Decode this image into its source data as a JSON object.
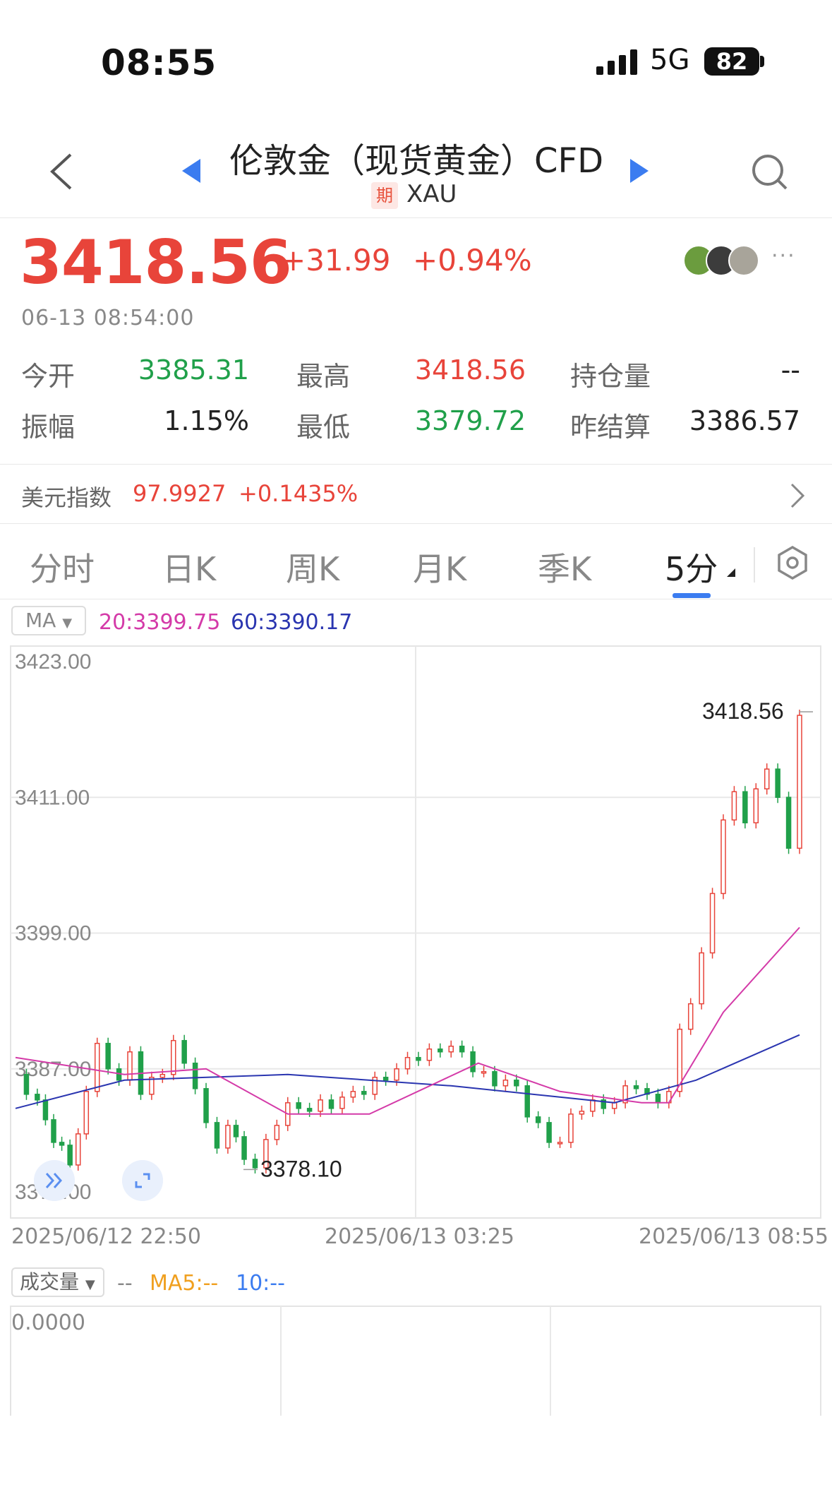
{
  "status": {
    "time": "08:55",
    "network": "5G",
    "battery": "82"
  },
  "header": {
    "title": "伦敦金（现货黄金）CFD",
    "tag": "期",
    "code": "XAU"
  },
  "quote": {
    "price": "3418.56",
    "change": "+31.99",
    "change_pct": "+0.94%",
    "timestamp": "06-13 08:54:00",
    "more": "···"
  },
  "stats": [
    {
      "label": "今开",
      "value": "3385.31",
      "color": "green"
    },
    {
      "label": "最高",
      "value": "3418.56",
      "color": "red"
    },
    {
      "label": "持仓量",
      "value": "--",
      "color": "dark"
    },
    {
      "label": "振幅",
      "value": "1.15%",
      "color": "dark"
    },
    {
      "label": "最低",
      "value": "3379.72",
      "color": "green"
    },
    {
      "label": "昨结算",
      "value": "3386.57",
      "color": "dark"
    }
  ],
  "usd_index": {
    "label": "美元指数",
    "value": "97.9927",
    "change": "+0.1435%"
  },
  "tabs": [
    "分时",
    "日K",
    "周K",
    "月K",
    "季K",
    "5分"
  ],
  "active_tab": "5分",
  "indicators": {
    "ma_label": "MA",
    "ma20": "20:3399.75",
    "ma60": "60:3390.17"
  },
  "colors": {
    "up": "#e8443a",
    "down": "#20a04a",
    "ma20": "#d43aa8",
    "ma60": "#2a35b0",
    "accent": "#3b7cf0"
  },
  "chart_data": {
    "type": "candlestick",
    "y_ticks": [
      "3423.00",
      "3411.00",
      "3399.00",
      "3387.00",
      "3375.00"
    ],
    "ylim": [
      3375,
      3423
    ],
    "x_labels": [
      "2025/06/12 22:50",
      "2025/06/13 03:25",
      "2025/06/13 08:55"
    ],
    "high_marker": "3418.56",
    "low_marker": "3378.10",
    "grid": true
  },
  "volume": {
    "label": "成交量",
    "dash": "--",
    "ma5": "MA5:--",
    "ma10": "10:--",
    "zero": "0.0000"
  }
}
